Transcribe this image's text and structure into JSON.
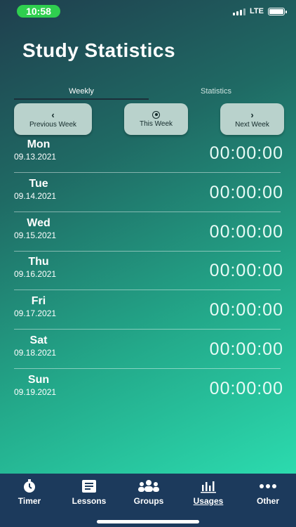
{
  "status_bar": {
    "time": "10:58",
    "network": "LTE",
    "time_pill_color": "#2fcf4f"
  },
  "page_title": "Study Statistics",
  "tabs": {
    "weekly": "Weekly",
    "statistics": "Statistics",
    "active": "Weekly"
  },
  "week_nav": {
    "previous": "Previous Week",
    "this": "This Week",
    "next": "Next Week"
  },
  "days": [
    {
      "name": "Mon",
      "date": "09.13.2021",
      "time": "00:00:00"
    },
    {
      "name": "Tue",
      "date": "09.14.2021",
      "time": "00:00:00"
    },
    {
      "name": "Wed",
      "date": "09.15.2021",
      "time": "00:00:00"
    },
    {
      "name": "Thu",
      "date": "09.16.2021",
      "time": "00:00:00"
    },
    {
      "name": "Fri",
      "date": "09.17.2021",
      "time": "00:00:00"
    },
    {
      "name": "Sat",
      "date": "09.18.2021",
      "time": "00:00:00"
    },
    {
      "name": "Sun",
      "date": "09.19.2021",
      "time": "00:00:00"
    }
  ],
  "bottom_nav": {
    "items": [
      {
        "label": "Timer",
        "icon": "stopwatch-icon"
      },
      {
        "label": "Lessons",
        "icon": "book-icon"
      },
      {
        "label": "Groups",
        "icon": "people-icon"
      },
      {
        "label": "Usages",
        "icon": "bar-chart-icon"
      },
      {
        "label": "Other",
        "icon": "more-icon"
      }
    ],
    "active": "Usages",
    "background": "#1c3a5c"
  }
}
